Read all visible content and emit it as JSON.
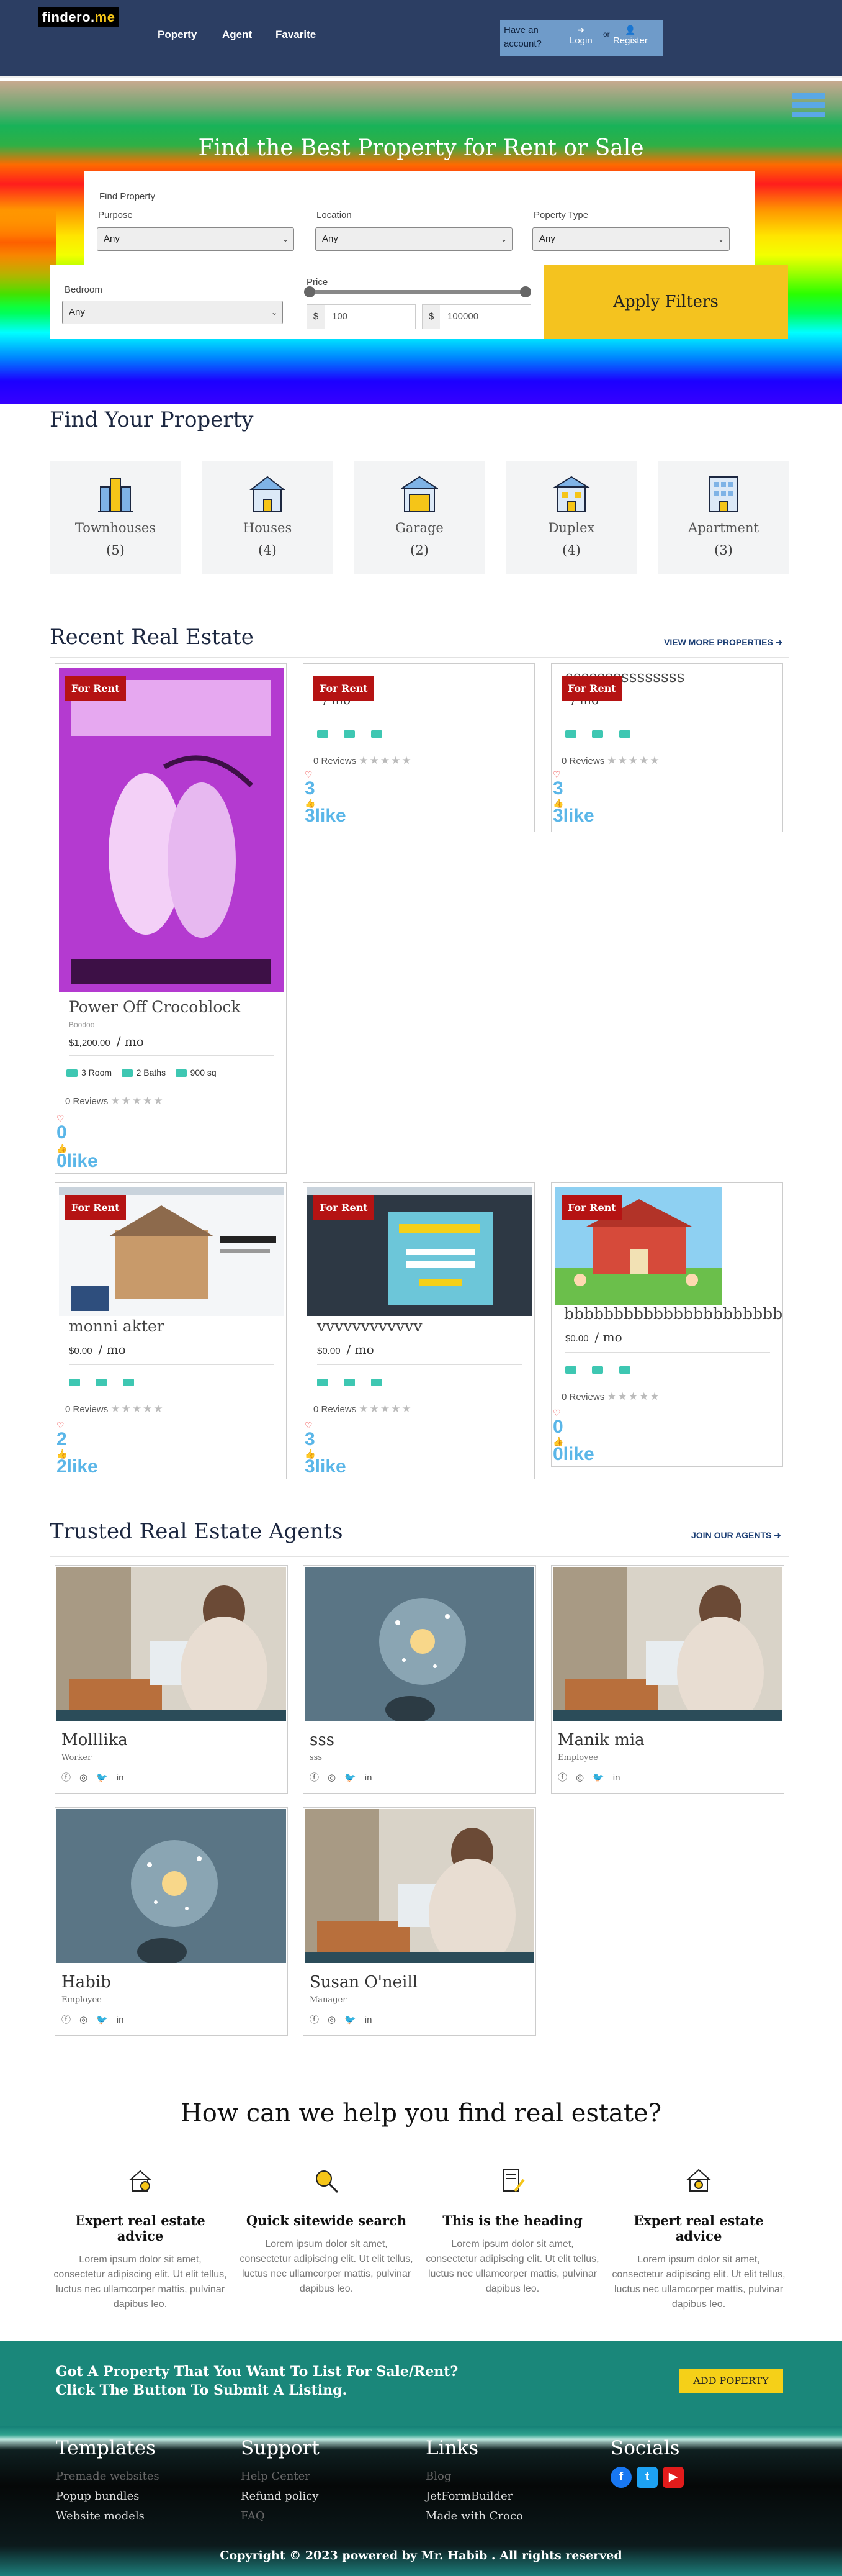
{
  "header": {
    "logo_main": "findero.",
    "logo_tld": "me",
    "nav": [
      "Poperty",
      "Agent",
      "Favarite"
    ],
    "account_question": "Have an account?",
    "login": "Login",
    "or": "or",
    "register": "Register"
  },
  "hero": {
    "title": "Find the Best Property for Rent or Sale",
    "find_label": "Find Property",
    "purpose_label": "Purpose",
    "purpose_value": "Any",
    "location_label": "Location",
    "location_value": "Any",
    "type_label": "Poperty Type",
    "type_value": "Any",
    "bedroom_label": "Bedroom",
    "bedroom_value": "Any",
    "price_label": "Price",
    "currency": "$",
    "price_min": "100",
    "price_max": "100000",
    "apply": "Apply Filters"
  },
  "categories": {
    "title": "Find Your Property",
    "items": [
      {
        "name": "Townhouses",
        "count": "(5)"
      },
      {
        "name": "Houses",
        "count": "(4)"
      },
      {
        "name": "Garage",
        "count": "(2)"
      },
      {
        "name": "Duplex",
        "count": "(4)"
      },
      {
        "name": "Apartment",
        "count": "(3)"
      }
    ]
  },
  "recent": {
    "title": "Recent Real Estate",
    "view_more": "VIEW MORE PROPERTIES",
    "tag": "For Rent",
    "per": "/ mo",
    "reviews": "0 Reviews",
    "cards": [
      {
        "title": "Power Off Crocoblock",
        "location": "Boodoo",
        "price": "$1,200.00",
        "rooms": "3 Room",
        "baths": "2 Baths",
        "area": "900 sq",
        "count": "0",
        "likes": "0like"
      },
      {
        "title": "",
        "price": "",
        "count": "3",
        "likes": "3like"
      },
      {
        "title": "sssssssssssssss",
        "price": "",
        "count": "3",
        "likes": "3like"
      },
      {
        "title": "monni akter",
        "price": "$0.00",
        "count": "2",
        "likes": "2like"
      },
      {
        "title": "vvvvvvvvvvvv",
        "price": "$0.00",
        "count": "3",
        "likes": "3like"
      },
      {
        "title": "bbbbbbbbbbbbbbbbbbbbbb",
        "price": "$0.00",
        "count": "0",
        "likes": "0like"
      }
    ]
  },
  "agents": {
    "title": "Trusted Real Estate Agents",
    "join": "JOIN OUR AGENTS",
    "items": [
      {
        "name": "Molllika",
        "role": "Worker"
      },
      {
        "name": "sss",
        "role": "sss"
      },
      {
        "name": "Manik mia",
        "role": "Employee"
      },
      {
        "name": "Habib",
        "role": "Employee"
      },
      {
        "name": "Susan O'neill",
        "role": "Manager"
      }
    ]
  },
  "help": {
    "title": "How can we help you find real estate?",
    "items": [
      {
        "title": "Expert real estate advice",
        "desc": "Lorem ipsum dolor sit amet, consectetur adipiscing elit. Ut elit tellus, luctus nec ullamcorper mattis, pulvinar dapibus leo."
      },
      {
        "title": "Quick sitewide search",
        "desc": "Lorem ipsum dolor sit amet, consectetur adipiscing elit. Ut elit tellus, luctus nec ullamcorper mattis, pulvinar dapibus leo."
      },
      {
        "title": "This is the heading",
        "desc": "Lorem ipsum dolor sit amet, consectetur adipiscing elit. Ut elit tellus, luctus nec ullamcorper mattis, pulvinar dapibus leo."
      },
      {
        "title": "Expert real estate advice",
        "desc": "Lorem ipsum dolor sit amet, consectetur adipiscing elit. Ut elit tellus, luctus nec ullamcorper mattis, pulvinar dapibus leo."
      }
    ]
  },
  "cta": {
    "line1": "Got A Property That You Want To List For Sale/Rent?",
    "line2": "Click The Button To Submit A Listing.",
    "button": "ADD POPERTY"
  },
  "footer": {
    "templates": {
      "title": "Templates",
      "items": [
        "Premade websites",
        "Popup bundles",
        "Website models"
      ]
    },
    "support": {
      "title": "Support",
      "items": [
        "Help Center",
        "Refund policy",
        "FAQ"
      ]
    },
    "links": {
      "title": "Links",
      "items": [
        "Blog",
        "JetFormBuilder",
        "Made with Croco"
      ]
    },
    "socials": {
      "title": "Socials"
    },
    "copyright": "Copyright © 2023 powered by Mr. Habib . All rights reserved"
  },
  "colors": {
    "header_bg": "#2c3e63",
    "accent_yellow": "#f4c31f",
    "tag_red": "#b51313",
    "like_blue": "#5ab6e8",
    "cta_teal": "#1a877a"
  }
}
